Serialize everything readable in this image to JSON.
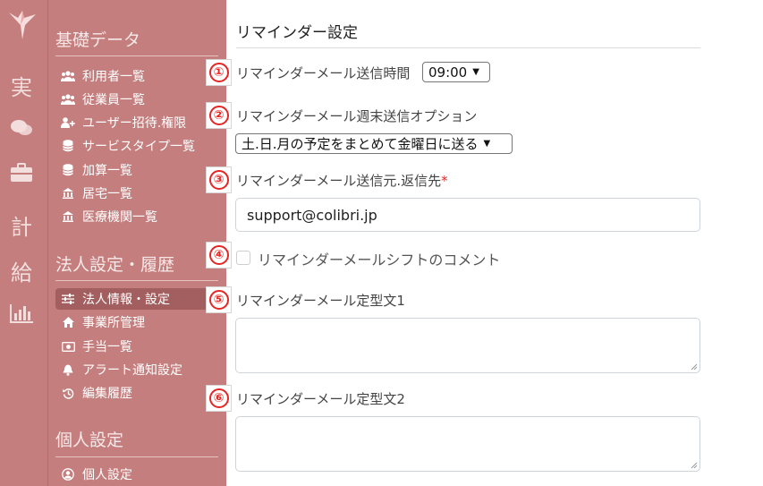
{
  "rail": {
    "items": [
      {
        "name": "jitsu",
        "glyph": "実"
      },
      {
        "name": "chat",
        "glyph": ""
      },
      {
        "name": "briefcase",
        "glyph": ""
      },
      {
        "name": "kei",
        "glyph": "計"
      },
      {
        "name": "kyu",
        "glyph": "給"
      },
      {
        "name": "chart",
        "glyph": ""
      }
    ]
  },
  "sidebar": {
    "sections": [
      {
        "title": "基礎データ",
        "items": [
          {
            "label": "利用者一覧",
            "icon": "users-icon"
          },
          {
            "label": "従業員一覧",
            "icon": "users-icon"
          },
          {
            "label": "ユーザー招待.権限",
            "icon": "user-plus-icon"
          },
          {
            "label": "サービスタイプ一覧",
            "icon": "database-icon"
          },
          {
            "label": "加算一覧",
            "icon": "database-icon"
          },
          {
            "label": "居宅一覧",
            "icon": "bank-icon"
          },
          {
            "label": "医療機関一覧",
            "icon": "bank-icon"
          }
        ]
      },
      {
        "title": "法人設定・履歴",
        "items": [
          {
            "label": "法人情報・設定",
            "icon": "sliders-icon",
            "active": true
          },
          {
            "label": "事業所管理",
            "icon": "home-icon"
          },
          {
            "label": "手当一覧",
            "icon": "money-icon"
          },
          {
            "label": "アラート通知設定",
            "icon": "bell-icon"
          },
          {
            "label": "編集履歴",
            "icon": "history-icon"
          }
        ]
      },
      {
        "title": "個人設定",
        "items": [
          {
            "label": "個人設定",
            "icon": "user-circle-icon"
          }
        ]
      }
    ]
  },
  "main": {
    "title": "リマインダー設定",
    "badges": [
      "①",
      "②",
      "③",
      "④",
      "⑤",
      "⑥"
    ],
    "send_time": {
      "label": "リマインダーメール送信時間",
      "value": "09:00"
    },
    "weekend": {
      "label": "リマインダーメール週末送信オプション",
      "value": "土.日.月の予定をまとめて金曜日に送る"
    },
    "sender": {
      "label": "リマインダーメール送信元.返信先",
      "required_mark": "*",
      "value": "support@colibri.jp"
    },
    "shift_comment": {
      "label": "リマインダーメールシフトのコメント",
      "checked": false
    },
    "template1": {
      "label": "リマインダーメール定型文1",
      "value": ""
    },
    "template2": {
      "label": "リマインダーメール定型文2",
      "value": ""
    }
  },
  "colors": {
    "sidebar_bg": "#c47e7e",
    "sidebar_active": "#a35f5f",
    "badge_red": "#e62525"
  }
}
